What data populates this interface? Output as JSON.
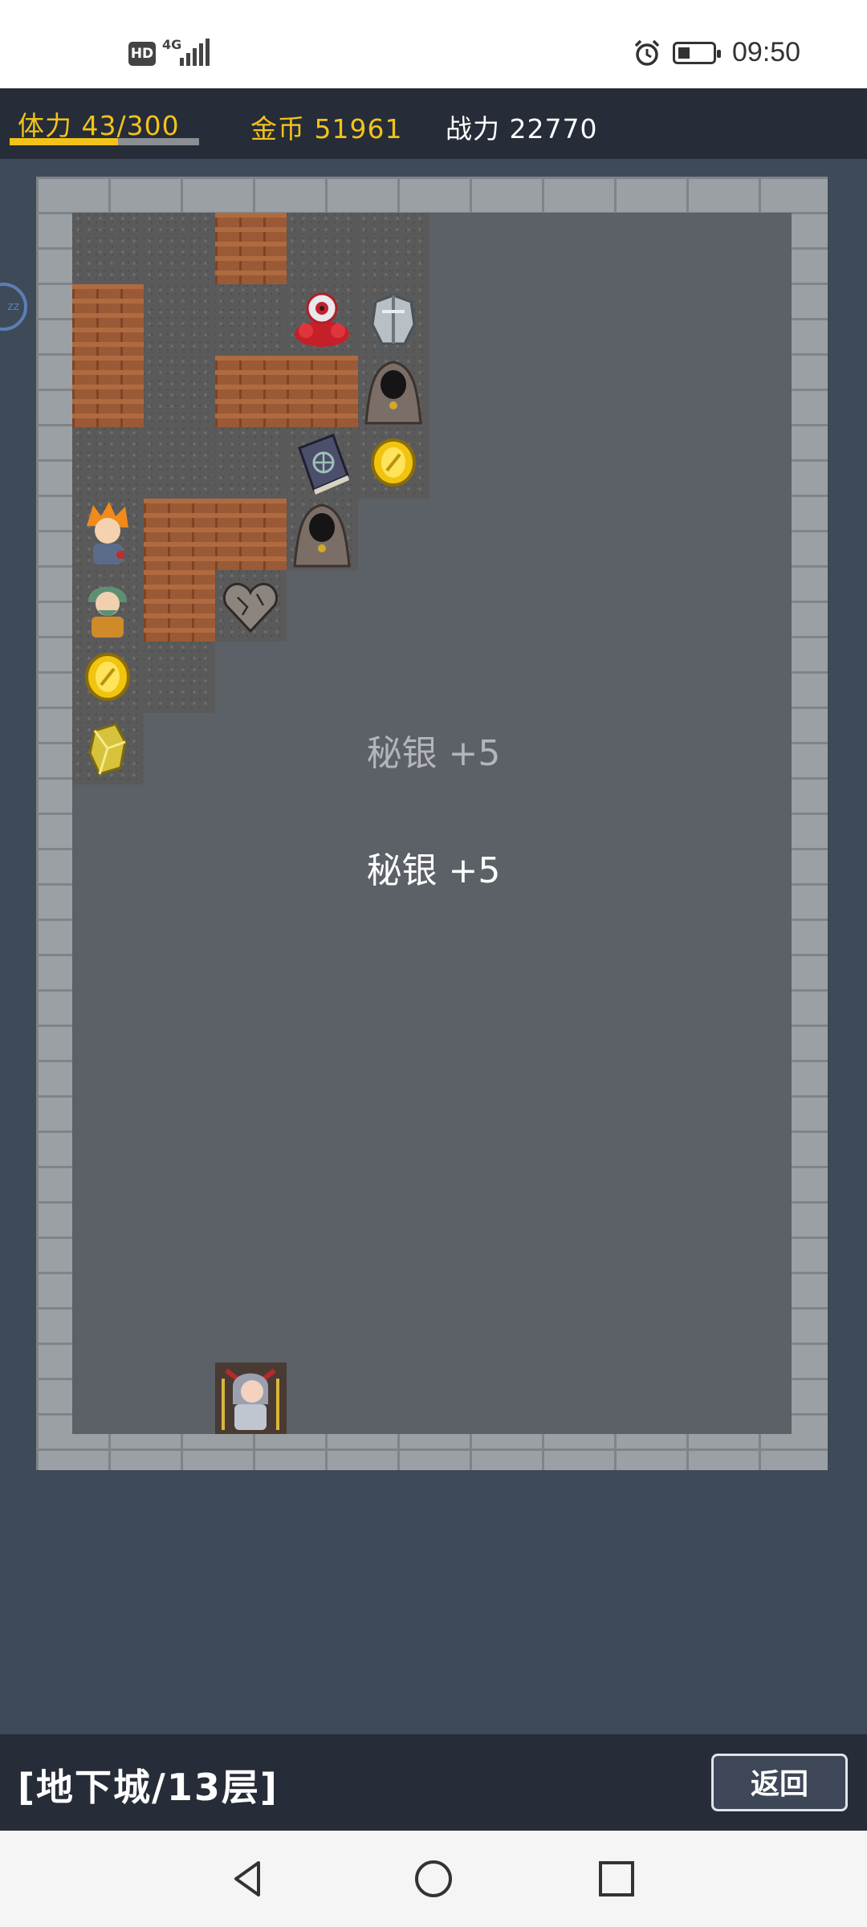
{
  "status_bar": {
    "hd": "HD",
    "network": "4G",
    "time": "09:50"
  },
  "stats": {
    "stamina_text": "体力 43/300",
    "stamina_fraction": 0.1433,
    "gold_text": "金币 51961",
    "power_text": "战力 22770",
    "stamina_color": "#f2c31a"
  },
  "float_messages": [
    {
      "text": "秘银 +5",
      "color": "#b3b5ba"
    },
    {
      "text": "秘银 +5",
      "color": "#ffffff"
    }
  ],
  "map": {
    "sprites": [
      "red-eyeball-slime",
      "silver-armor",
      "hooded-wraith",
      "dark-spellbook",
      "gold-coin",
      "hooded-wraith",
      "orange-hair-npc",
      "green-hair-npc",
      "stone-heart",
      "gold-coin",
      "gold-gem",
      "hero-player"
    ]
  },
  "bottom_bar": {
    "floor_label": "[地下城/13层]",
    "back_label": "返回"
  },
  "side_widget": {
    "label": "zz"
  }
}
